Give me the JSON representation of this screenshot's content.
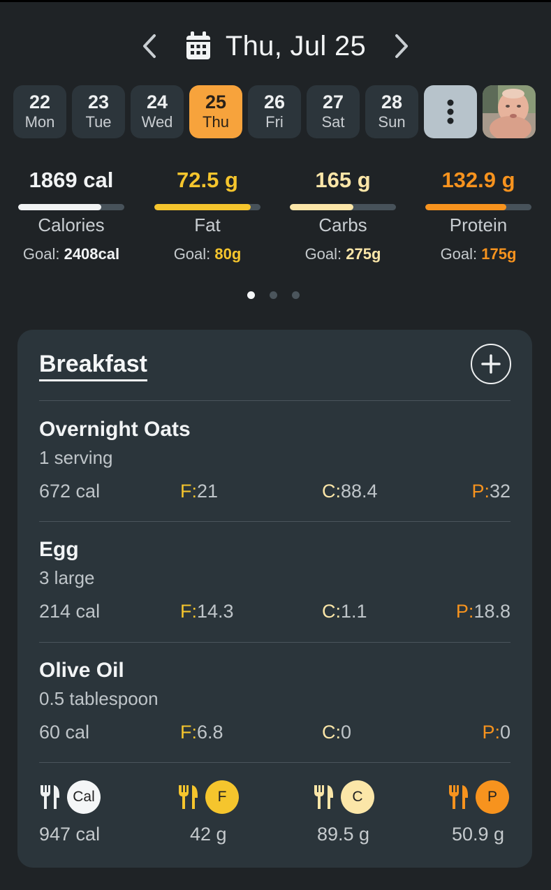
{
  "header": {
    "date_label": "Thu, Jul 25"
  },
  "days": [
    {
      "num": "22",
      "dow": "Mon"
    },
    {
      "num": "23",
      "dow": "Tue"
    },
    {
      "num": "24",
      "dow": "Wed"
    },
    {
      "num": "25",
      "dow": "Thu"
    },
    {
      "num": "26",
      "dow": "Fri"
    },
    {
      "num": "27",
      "dow": "Sat"
    },
    {
      "num": "28",
      "dow": "Sun"
    }
  ],
  "summary": {
    "calories": {
      "value": "1869 cal",
      "label": "Calories",
      "goal_prefix": "Goal: ",
      "goal": "2408cal",
      "progress": 0.78,
      "color": "#f1f3f4"
    },
    "fat": {
      "value": "72.5 g",
      "label": "Fat",
      "goal_prefix": "Goal: ",
      "goal": "80g",
      "progress": 0.91,
      "color": "#f5c52d"
    },
    "carbs": {
      "value": "165 g",
      "label": "Carbs",
      "goal_prefix": "Goal: ",
      "goal": "275g",
      "progress": 0.6,
      "color": "#fbe6a8"
    },
    "protein": {
      "value": "132.9 g",
      "label": "Protein",
      "goal_prefix": "Goal: ",
      "goal": "175g",
      "progress": 0.76,
      "color": "#f7931e"
    }
  },
  "meal": {
    "title": "Breakfast",
    "foods": [
      {
        "name": "Overnight Oats",
        "serving": "1 serving",
        "cal": "672 cal",
        "f_key": "F:",
        "f": "21",
        "c_key": "C:",
        "c": "88.4",
        "p_key": "P:",
        "p": "32"
      },
      {
        "name": "Egg",
        "serving": "3 large",
        "cal": "214 cal",
        "f_key": "F:",
        "f": "14.3",
        "c_key": "C:",
        "c": "1.1",
        "p_key": "P:",
        "p": "18.8"
      },
      {
        "name": "Olive Oil",
        "serving": "0.5 tablespoon",
        "cal": "60 cal",
        "f_key": "F:",
        "f": "6.8",
        "c_key": "C:",
        "c": "0",
        "p_key": "P:",
        "p": "0"
      }
    ],
    "totals": {
      "cal_badge": "Cal",
      "cal": "947 cal",
      "f_badge": "F",
      "f": "42 g",
      "c_badge": "C",
      "c": "89.5 g",
      "p_badge": "P",
      "p": "50.9 g"
    }
  },
  "colors": {
    "accent": "#f7a33c",
    "fat": "#f5c52d",
    "carbs": "#fbe6a8",
    "protein": "#f7931e",
    "card": "#2b353b",
    "background": "#1f2326"
  }
}
